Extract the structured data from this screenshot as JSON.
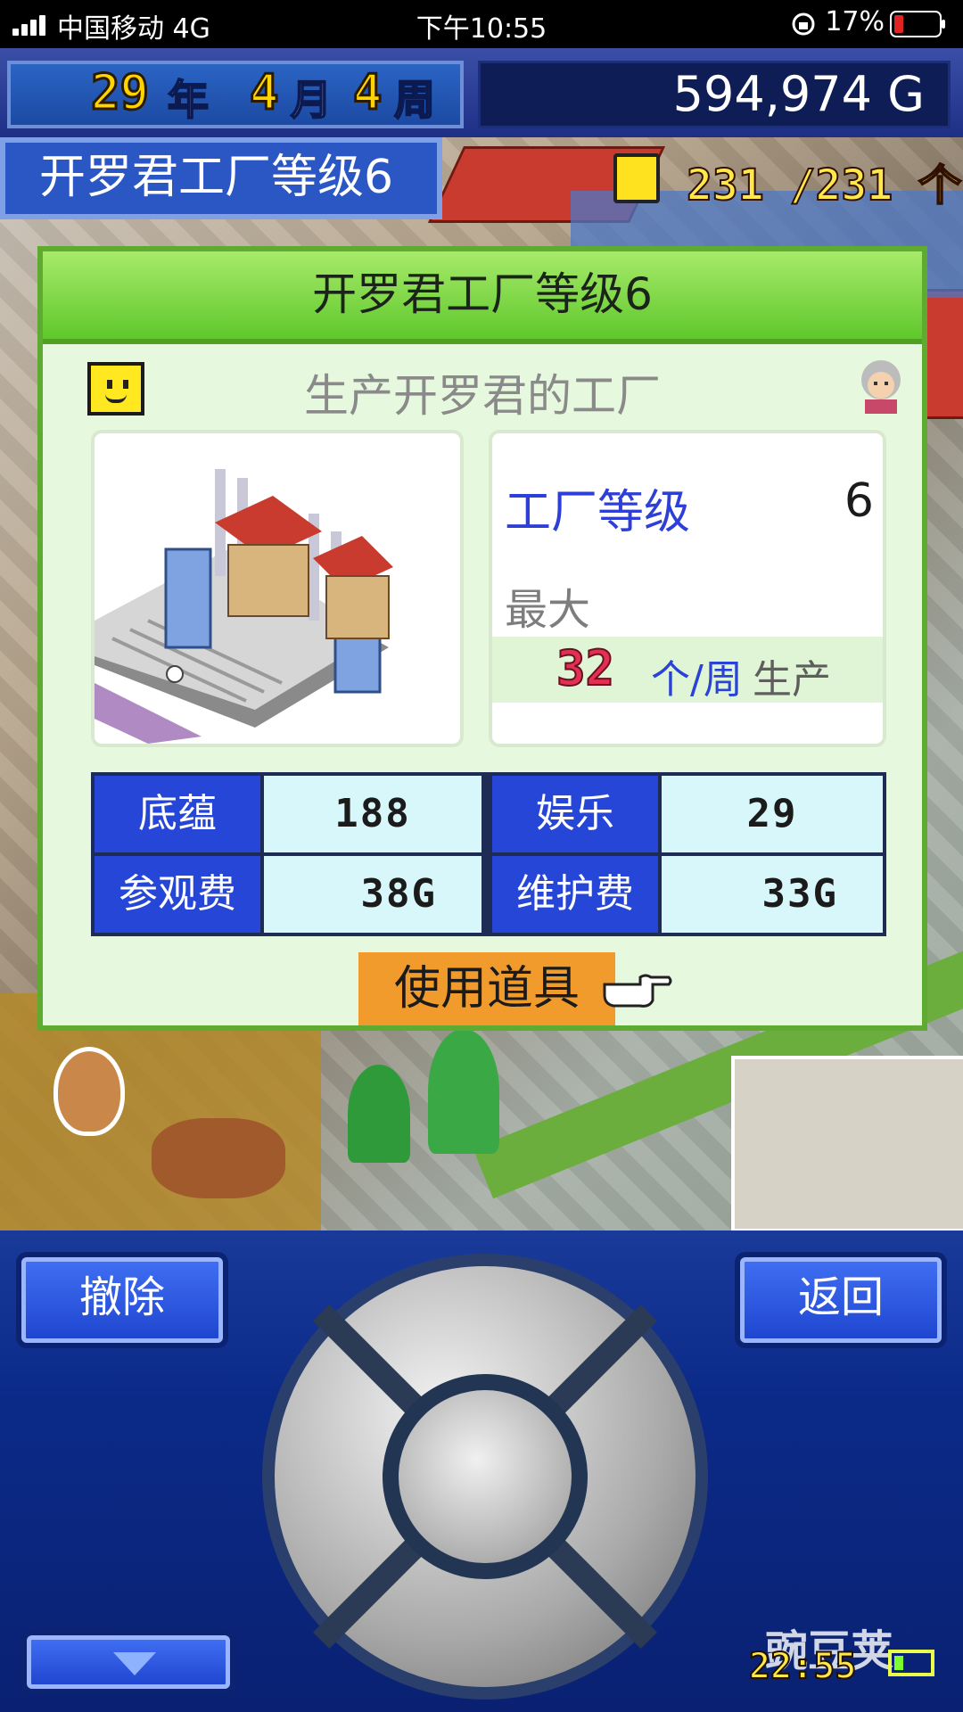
{
  "status_bar": {
    "carrier": "中国移动   4G",
    "time": "下午10:55",
    "battery": "17%",
    "battery_color": "#e02424"
  },
  "top_bar": {
    "year": "29",
    "year_unit": "年",
    "month": "4",
    "month_unit": "月",
    "week": "4",
    "week_unit": "周",
    "money": "594,974 G"
  },
  "building_title": "开罗君工厂等级6",
  "population": "231 /231 个",
  "dialog": {
    "title": "开罗君工厂等级6",
    "subtitle": "生产开罗君的工厂",
    "level_label": "工厂等级",
    "level_value": "6",
    "max_label": "最大",
    "production_value": "32",
    "production_unit": "个/周",
    "production_label": "生产",
    "stats": {
      "foundation_label": "底蕴",
      "foundation_value": "188",
      "entertainment_label": "娱乐",
      "entertainment_value": "29",
      "visit_fee_label": "参观费",
      "visit_fee_value": "38G",
      "maintenance_label": "维护费",
      "maintenance_value": "33G"
    },
    "use_item_button": "使用道具"
  },
  "controls": {
    "remove_button": "撤除",
    "back_button": "返回",
    "game_clock": "22:55",
    "watermark": "豌豆荚"
  },
  "colors": {
    "dialog_header": "#5fc82c",
    "label_blue": "#2546d6",
    "value_cyan": "#d8f7fa",
    "accent_orange": "#f19b2d",
    "production_red": "#e23150"
  }
}
